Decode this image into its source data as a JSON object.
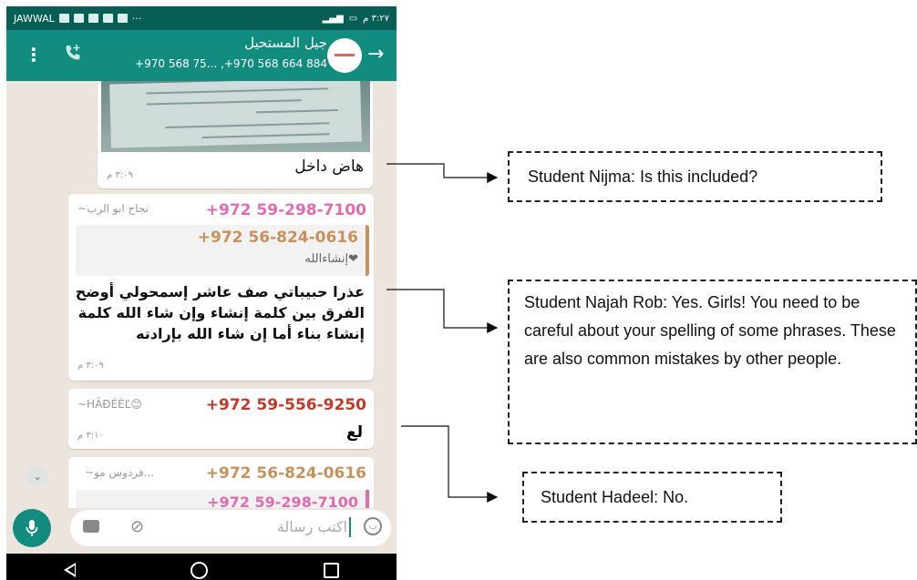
{
  "status_bar": {
    "carrier": "JAWWAL",
    "time": "٣:٢٧ م"
  },
  "header": {
    "title": "جيل المستحيل",
    "subtitle": "+970 568 75... ,+970 568 664 884",
    "colors": {
      "bar": "#128c7e",
      "status": "#075e54"
    }
  },
  "messages": [
    {
      "text": "هاض داخل",
      "time": "٣:٠٩ م"
    },
    {
      "sender_number": "+972 59-298-7100",
      "sender_name": "~نجاح ابو الرب",
      "quote": {
        "number": "+972 56-824-0616",
        "text": "إنشاءالله❤"
      },
      "text": "عذرا حبيباتي صف عاشر إسمحولي أوضح الفرق بين كلمة إنشاء وإن شاء الله كلمة إنشاء بناء أما إن شاء الله بإرادته",
      "time": "٣:٠٩ م"
    },
    {
      "sender_number": "+972 59-556-9250",
      "sender_name": "~HÂĐÉÉĽ😊",
      "text": "لع",
      "time": "٣:١٠ م"
    },
    {
      "sender_number": "+972 56-824-0616",
      "sender_name": "~فردوس مو...",
      "quote": {
        "number": "+972 59-298-7100"
      }
    }
  ],
  "input": {
    "placeholder": "اكتب رسالة"
  },
  "annotations": [
    "Student Nijma: Is this included?",
    "Student Najah Rob: Yes. Girls! You need to be careful about your spelling of some phrases. These are also common mistakes by other people.",
    "Student Hadeel: No."
  ]
}
